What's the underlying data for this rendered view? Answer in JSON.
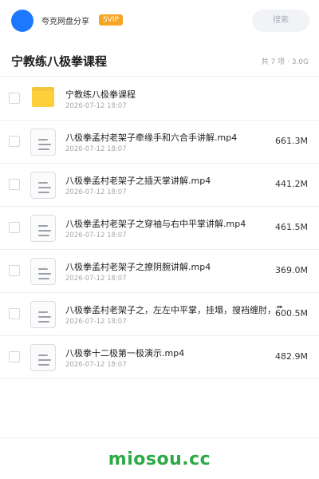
{
  "header": {
    "share_name": "夸克网盘分享",
    "badge": "SVIP",
    "search_placeholder": "搜索"
  },
  "folder": {
    "title": "宁教练八极拳课程",
    "meta": "共 7 项 · 3.0G"
  },
  "files": [
    {
      "type": "folder",
      "icon": "folder-icon",
      "name": "宁教练八极拳课程",
      "date": "2026-07-12 18:07",
      "size": ""
    },
    {
      "type": "file",
      "icon": "document-icon",
      "name": "八极拳孟村老架子牵缘手和六合手讲解.mp4",
      "date": "2026-07-12 18:07",
      "size": "661.3M"
    },
    {
      "type": "file",
      "icon": "document-icon",
      "name": "八极拳孟村老架子之插天掌讲解.mp4",
      "date": "2026-07-12 18:07",
      "size": "441.2M"
    },
    {
      "type": "file",
      "icon": "document-icon",
      "name": "八极拳孟村老架子之穿袖与右中平掌讲解.mp4",
      "date": "2026-07-12 18:07",
      "size": "461.5M"
    },
    {
      "type": "file",
      "icon": "document-icon",
      "name": "八极拳孟村老架子之撩阴腕讲解.mp4",
      "date": "2026-07-12 18:07",
      "size": "369.0M"
    },
    {
      "type": "file",
      "icon": "document-icon",
      "name": "八极拳孟村老架子之，左左中平掌，挂塌，搜裆缠肘，霸",
      "date": "2026-07-12 18:07",
      "size": "600.5M"
    },
    {
      "type": "file",
      "icon": "document-icon",
      "name": "八极拳十二极第一极演示.mp4",
      "date": "2026-07-12 18:07",
      "size": "482.9M"
    }
  ],
  "watermark": "miosou.cc",
  "colors": {
    "avatar": "#1e78ff",
    "badge": "#f6a524",
    "folder": "#fdd03a",
    "watermark": "#2daa45"
  }
}
